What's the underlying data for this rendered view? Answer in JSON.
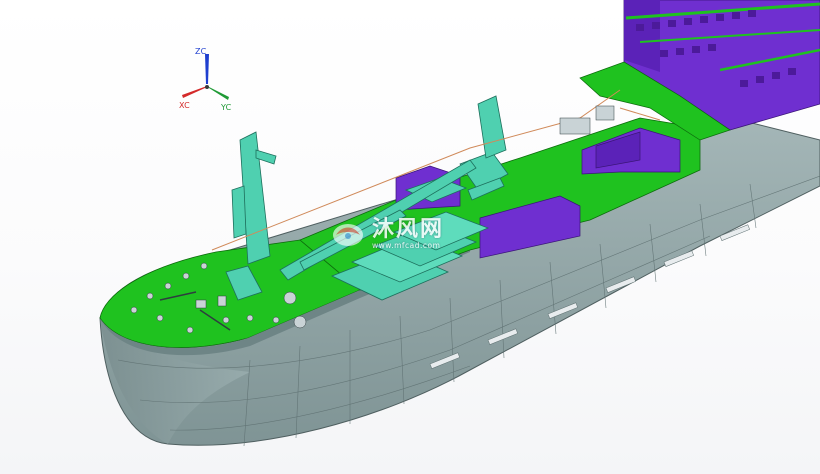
{
  "viewport": {
    "triad": {
      "z_label": "ZC",
      "x_label": "XC",
      "y_label": "YC",
      "colors": {
        "z": "#1f3fcf",
        "x": "#d42a2a",
        "y": "#1f9a35"
      }
    },
    "watermark": {
      "title": "沐风网",
      "url": "www.mfcad.com"
    },
    "model_colors": {
      "deck": "#1fc21f",
      "superstructure": "#6f2fd0",
      "hull": "#8fa3a4",
      "equipment": "#4fd0b0",
      "background": "#ffffff"
    }
  }
}
